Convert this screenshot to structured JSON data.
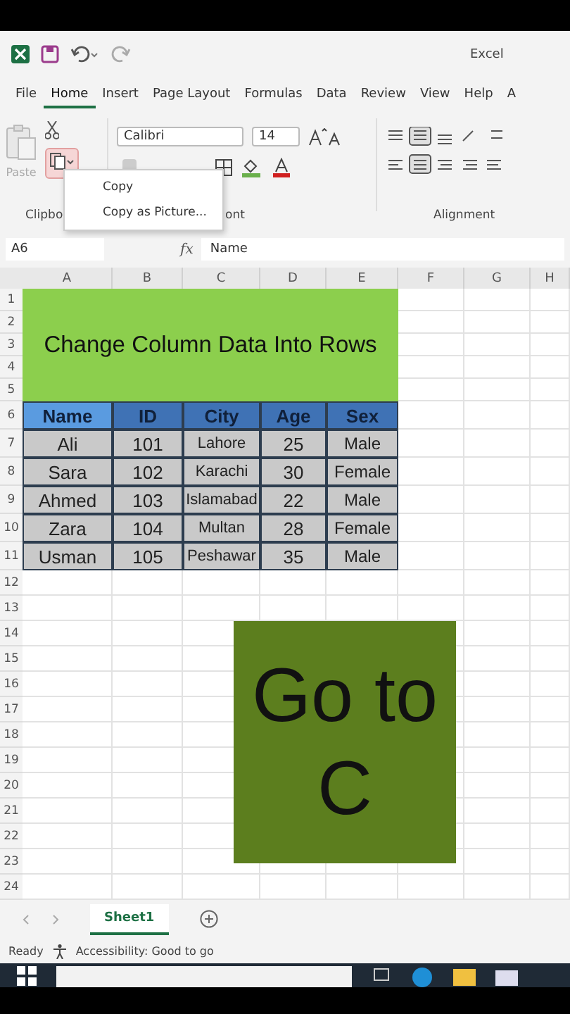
{
  "title_bar": {
    "app": "Excel"
  },
  "ribbon_tabs": [
    {
      "label": "File",
      "selected": false
    },
    {
      "label": "Home",
      "selected": true
    },
    {
      "label": "Insert",
      "selected": false
    },
    {
      "label": "Page Layout",
      "selected": false
    },
    {
      "label": "Formulas",
      "selected": false
    },
    {
      "label": "Data",
      "selected": false
    },
    {
      "label": "Review",
      "selected": false
    },
    {
      "label": "View",
      "selected": false
    },
    {
      "label": "Help",
      "selected": false
    },
    {
      "label": "A",
      "selected": false
    }
  ],
  "ribbon": {
    "paste_label": "Paste",
    "font_name": "Calibri",
    "font_size": "14",
    "groups": [
      "Clipbo",
      "ont",
      "Alignment"
    ]
  },
  "context_menu": {
    "items": [
      "Copy",
      "Copy as Picture..."
    ]
  },
  "formula_bar": {
    "name_box": "A6",
    "function_label": "fx",
    "formula": "Name"
  },
  "columns": [
    "A",
    "B",
    "C",
    "D",
    "E",
    "F",
    "G",
    "H"
  ],
  "row_numbers": [
    "1",
    "2",
    "3",
    "4",
    "5",
    "6",
    "7",
    "8",
    "9",
    "10",
    "11",
    "12",
    "13",
    "14",
    "15",
    "16",
    "17",
    "18",
    "19",
    "20",
    "21",
    "22",
    "23",
    "24"
  ],
  "sheet": {
    "title": "Change Column Data Into Rows",
    "table": {
      "headers": [
        {
          "text": "Name",
          "selected": true
        },
        {
          "text": "ID",
          "selected": false
        },
        {
          "text": "City",
          "selected": false
        },
        {
          "text": "Age",
          "selected": false
        },
        {
          "text": "Sex",
          "selected": false
        }
      ],
      "rows": [
        [
          "Ali",
          "101",
          "Lahore",
          "25",
          "Male"
        ],
        [
          "Sara",
          "102",
          "Karachi",
          "30",
          "Female"
        ],
        [
          "Ahmed",
          "103",
          "Islamabad",
          "22",
          "Male"
        ],
        [
          "Zara",
          "104",
          "Multan",
          "28",
          "Female"
        ],
        [
          "Usman",
          "105",
          "Peshawar",
          "35",
          "Male"
        ]
      ]
    }
  },
  "overlay": {
    "lines": [
      "Go to",
      "C"
    ]
  },
  "sheet_tabs": [
    {
      "label": "Sheet1",
      "selected": true
    }
  ],
  "status_bar": {
    "state": "Ready",
    "accessibility": "Accessibility: Good to go"
  }
}
